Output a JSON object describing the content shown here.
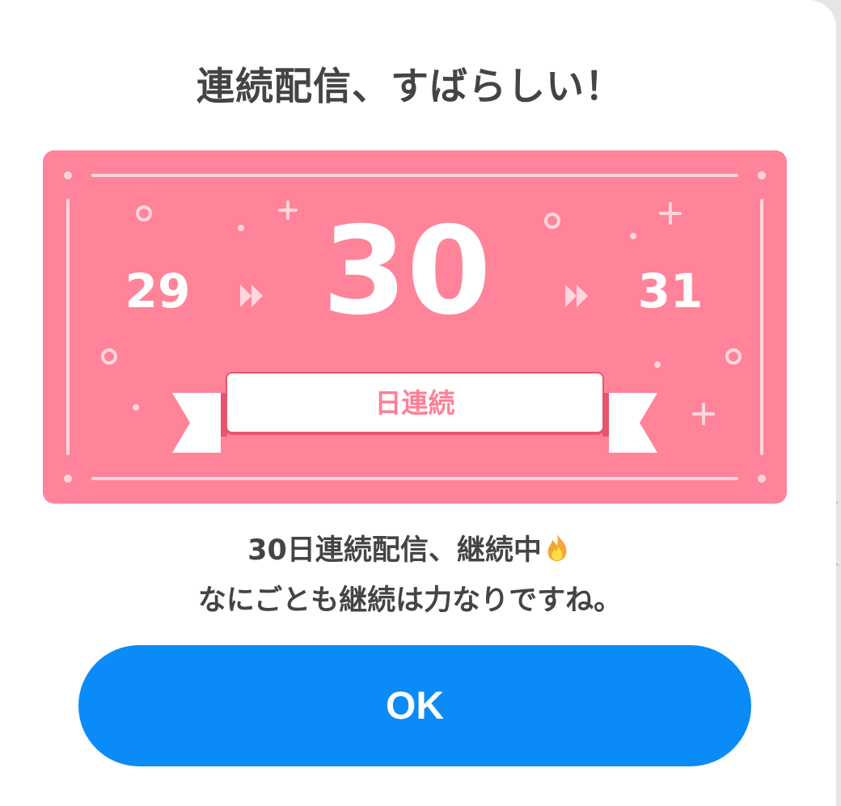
{
  "dialog": {
    "title": "連続配信、すばらしい！",
    "streak": {
      "previous_day": "29",
      "current_day": "30",
      "next_day": "31",
      "ribbon_label": "日連続"
    },
    "message_line1": "30日連続配信、継続中",
    "message_line2": "なにごとも継続は力なりですね。",
    "ok_button_label": "OK"
  },
  "colors": {
    "card": "#ff8499",
    "accent_text": "#ff7f96",
    "button": "#0a8bf7",
    "title_text": "#444444"
  },
  "icons": {
    "message_emoji": "flame-icon",
    "separator": "double-chevron-right-icon"
  }
}
